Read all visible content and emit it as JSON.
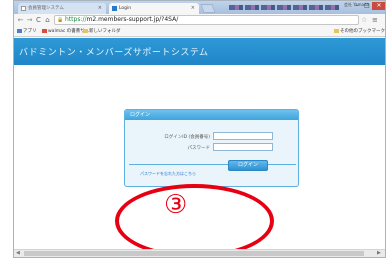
{
  "browser": {
    "tabs": [
      {
        "label": "会員管理システム"
      },
      {
        "label": "Login"
      }
    ],
    "tab_close": "×",
    "user_label": "会社 Yamada",
    "window_controls": {
      "minimize": "–",
      "maximize": "□",
      "close": "✕"
    },
    "nav": {
      "back": "←",
      "forward": "→",
      "reload": "C",
      "home": "⌂"
    },
    "url": {
      "scheme": "https://",
      "rest": "m2.members-support.jp/?4SA/"
    },
    "star": "☆",
    "menu": "≡",
    "bookmarks": [
      {
        "label": "アプリ"
      },
      {
        "label": "walmac の書斎サ..."
      },
      {
        "label": "新しいフォルダ"
      }
    ],
    "other_bookmarks": "その他のブックマーク"
  },
  "site": {
    "title": "バドミントン・メンバーズサポートシステム",
    "accent_color": "#1f86c8"
  },
  "login": {
    "heading": "ログイン",
    "id_label": "ログインID (会員番号)",
    "password_label": "パスワード",
    "id_value": "",
    "password_value": "",
    "forgot_link": "パスワードを忘れた方はこちら",
    "button_label": "ログイン"
  },
  "annotation": {
    "number": "③",
    "color": "#e60012"
  }
}
